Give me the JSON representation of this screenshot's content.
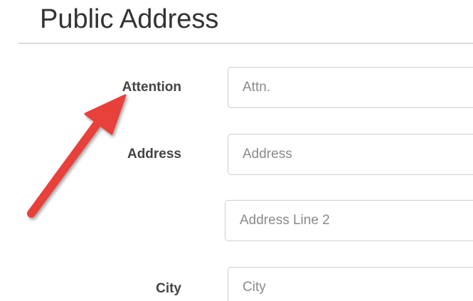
{
  "header": {
    "title": "Public Address"
  },
  "form": {
    "attention": {
      "label": "Attention",
      "placeholder": "Attn."
    },
    "address": {
      "label": "Address",
      "placeholder": "Address"
    },
    "address_line_2": {
      "placeholder": "Address Line 2"
    },
    "city": {
      "label": "City",
      "placeholder": "City"
    }
  },
  "annotation": {
    "arrow_color": "#e8403a",
    "icon": "red-pointer-arrow"
  }
}
